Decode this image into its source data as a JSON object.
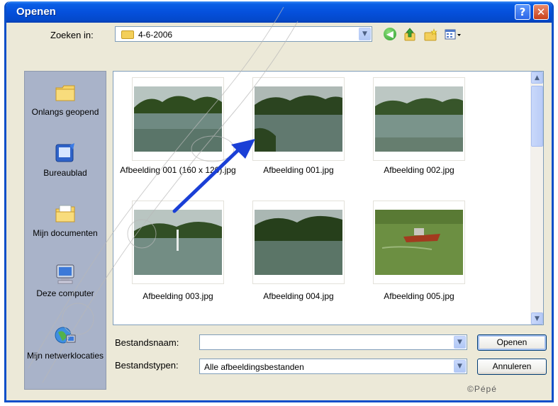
{
  "window": {
    "title": "Openen"
  },
  "look_in": {
    "label": "Zoeken in:",
    "value": "4-6-2006"
  },
  "toolbar": {
    "icons": [
      "back-icon",
      "up-folder-icon",
      "new-folder-icon",
      "views-menu-icon"
    ]
  },
  "places": [
    {
      "label": "Onlangs geopend",
      "icon": "recent-folder-icon"
    },
    {
      "label": "Bureaublad",
      "icon": "desktop-icon"
    },
    {
      "label": "Mijn documenten",
      "icon": "my-documents-icon"
    },
    {
      "label": "Deze computer",
      "icon": "computer-icon"
    },
    {
      "label": "Mijn netwerklocaties",
      "icon": "network-icon"
    }
  ],
  "files": [
    {
      "name": "Afbeelding 001 (160 x 120).jpg"
    },
    {
      "name": "Afbeelding 001.jpg"
    },
    {
      "name": "Afbeelding 002.jpg"
    },
    {
      "name": "Afbeelding 003.jpg"
    },
    {
      "name": "Afbeelding 004.jpg"
    },
    {
      "name": "Afbeelding 005.jpg"
    }
  ],
  "filename": {
    "label": "Bestandsnaam:",
    "value": ""
  },
  "filetype": {
    "label": "Bestandstypen:",
    "value": "Alle afbeeldingsbestanden"
  },
  "buttons": {
    "open": "Openen",
    "cancel": "Annuleren"
  },
  "credit": "©Pépé",
  "colors": {
    "titlebar": "#0550dc",
    "arrow": "#1a3fd6",
    "dialog_bg": "#ece9d8"
  }
}
